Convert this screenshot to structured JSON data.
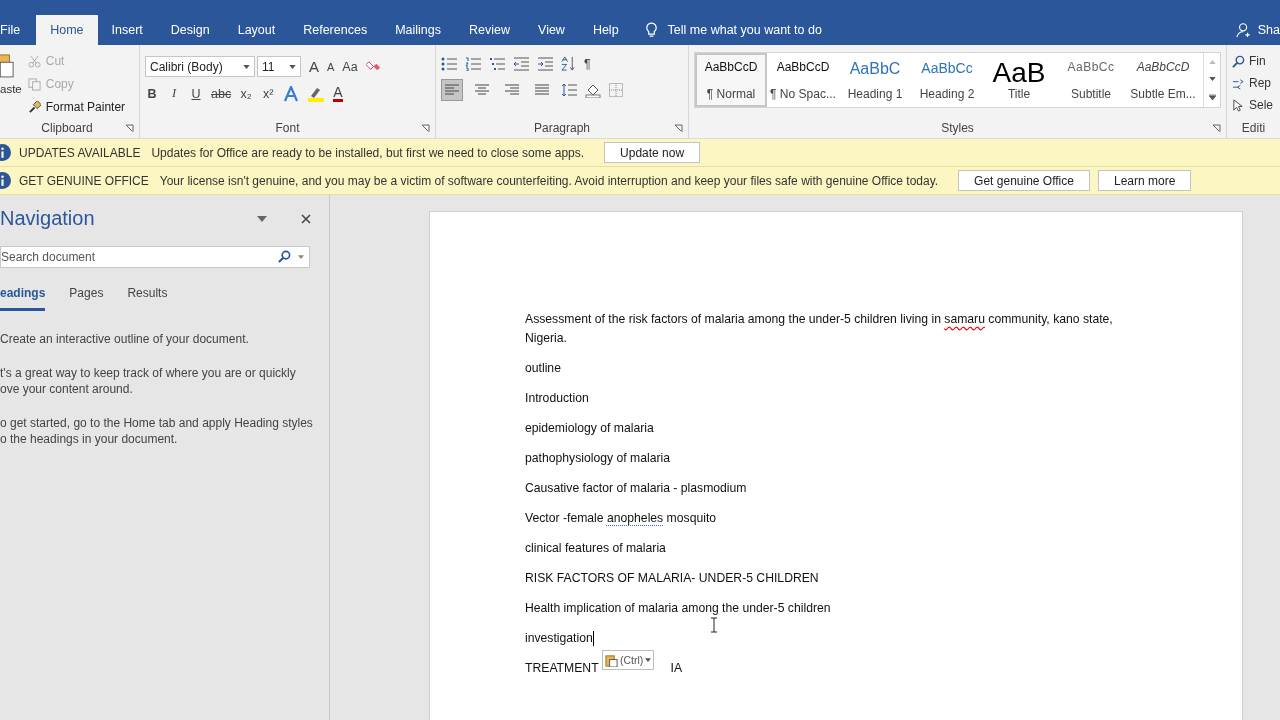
{
  "tabs": [
    {
      "label": "File",
      "selected": false
    },
    {
      "label": "Home",
      "selected": true
    },
    {
      "label": "Insert",
      "selected": false
    },
    {
      "label": "Design",
      "selected": false
    },
    {
      "label": "Layout",
      "selected": false
    },
    {
      "label": "References",
      "selected": false
    },
    {
      "label": "Mailings",
      "selected": false
    },
    {
      "label": "Review",
      "selected": false
    },
    {
      "label": "View",
      "selected": false
    },
    {
      "label": "Help",
      "selected": false
    }
  ],
  "tell_me": "Tell me what you want to do",
  "share": "Sha",
  "clipboard": {
    "paste": "aste",
    "label": "Clipboard",
    "items": [
      {
        "label": "Cut",
        "kind": "cut",
        "disabled": true
      },
      {
        "label": "Copy",
        "kind": "copy",
        "disabled": true
      },
      {
        "label": "Format Painter",
        "kind": "painter",
        "disabled": false
      }
    ]
  },
  "font": {
    "name": "Calibri (Body)",
    "size": "11",
    "grow": "A",
    "shrink": "A",
    "change_case": "Aa",
    "buttons": [
      "B",
      "I",
      "U",
      "abc",
      "x₂",
      "x²"
    ],
    "font_color": "A",
    "label": "Font"
  },
  "paragraph": {
    "label": "Paragraph",
    "pilcrow": "¶",
    "alignments": [
      {
        "kind": "left",
        "selected": true
      },
      {
        "kind": "center",
        "selected": false
      },
      {
        "kind": "right",
        "selected": false
      },
      {
        "kind": "justify",
        "selected": false
      }
    ]
  },
  "styles": {
    "label": "Styles",
    "items": [
      {
        "preview": "AaBbCcD",
        "name": "¶ Normal",
        "kind": "normal",
        "selected": true
      },
      {
        "preview": "AaBbCcD",
        "name": "¶ No Spac...",
        "kind": "normal",
        "selected": false
      },
      {
        "preview": "AaBbC",
        "name": "Heading 1",
        "kind": "heading1",
        "selected": false
      },
      {
        "preview": "AaBbCc",
        "name": "Heading 2",
        "kind": "heading2",
        "selected": false
      },
      {
        "preview": "AaB",
        "name": "Title",
        "kind": "title",
        "selected": false
      },
      {
        "preview": "AaBbCc",
        "name": "Subtitle",
        "kind": "subtitle",
        "selected": false
      },
      {
        "preview": "AaBbCcD",
        "name": "Subtle Em...",
        "kind": "emphasis",
        "selected": false
      }
    ]
  },
  "editing": {
    "label": "Editi",
    "items": [
      {
        "label": "Fin",
        "kind": "find"
      },
      {
        "label": "Rep",
        "kind": "replace"
      },
      {
        "label": "Sele",
        "kind": "select"
      }
    ]
  },
  "messages": [
    {
      "title": "UPDATES AVAILABLE",
      "text": "Updates for Office are ready to be installed, but first we need to close some apps.",
      "buttons": [
        "Update now"
      ]
    },
    {
      "title": "GET GENUINE OFFICE",
      "text": "Your license isn't genuine, and you may be a victim of software counterfeiting. Avoid interruption and keep your files safe with genuine Office today.",
      "buttons": [
        "Get genuine Office",
        "Learn more"
      ]
    }
  ],
  "navigation": {
    "title": "Navigation",
    "search": {
      "placeholder": "Search document"
    },
    "tabs": [
      {
        "label": "eadings",
        "selected": true
      },
      {
        "label": "Pages",
        "selected": false
      },
      {
        "label": "Results",
        "selected": false
      }
    ],
    "paragraphs": [
      [
        "Create an interactive outline of your document."
      ],
      [
        "t's a great way to keep track of where you are or quickly",
        "ove your content around."
      ],
      [
        "o get started, go to the Home tab and apply Heading styles",
        "o the headings in your document."
      ]
    ]
  },
  "document": {
    "paste_options": "(Ctrl)",
    "paragraphs": [
      {
        "kind": "text",
        "cursor": false,
        "segments": [
          {
            "text": "Assessment of the risk factors of malaria among the under-5 children living in ",
            "kind": "plain"
          },
          {
            "text": "samaru",
            "kind": "spelling"
          },
          {
            "text": " community, kano state, Nigeria.",
            "kind": "plain"
          }
        ]
      },
      {
        "kind": "text",
        "cursor": false,
        "segments": [
          {
            "text": "outline",
            "kind": "plain"
          }
        ]
      },
      {
        "kind": "text",
        "cursor": false,
        "segments": [
          {
            "text": "Introduction",
            "kind": "plain"
          }
        ]
      },
      {
        "kind": "text",
        "cursor": false,
        "segments": [
          {
            "text": "epidemiology of malaria",
            "kind": "plain"
          }
        ]
      },
      {
        "kind": "text",
        "cursor": false,
        "segments": [
          {
            "text": "pathophysiology of malaria",
            "kind": "plain"
          }
        ]
      },
      {
        "kind": "text",
        "cursor": false,
        "segments": [
          {
            "text": "Causative factor of malaria - plasmodium",
            "kind": "plain"
          }
        ]
      },
      {
        "kind": "text",
        "cursor": false,
        "segments": [
          {
            "text": "Vector -female ",
            "kind": "plain"
          },
          {
            "text": "anopheles",
            "kind": "grammar"
          },
          {
            "text": " mosquito",
            "kind": "plain"
          }
        ]
      },
      {
        "kind": "text",
        "cursor": false,
        "segments": [
          {
            "text": "clinical features of malaria",
            "kind": "plain"
          }
        ]
      },
      {
        "kind": "text",
        "cursor": false,
        "segments": [
          {
            "text": "RISK FACTORS OF MALARIA- UNDER-5 CHILDREN",
            "kind": "plain"
          }
        ]
      },
      {
        "kind": "text",
        "cursor": false,
        "segments": [
          {
            "text": "Health implication of malaria among the under-5 children",
            "kind": "plain"
          }
        ]
      },
      {
        "kind": "text",
        "cursor": true,
        "segments": [
          {
            "text": "investigation",
            "kind": "plain"
          }
        ]
      },
      {
        "kind": "paste",
        "cursor": false,
        "before": "TREATMENT",
        "after": "IA"
      }
    ]
  }
}
